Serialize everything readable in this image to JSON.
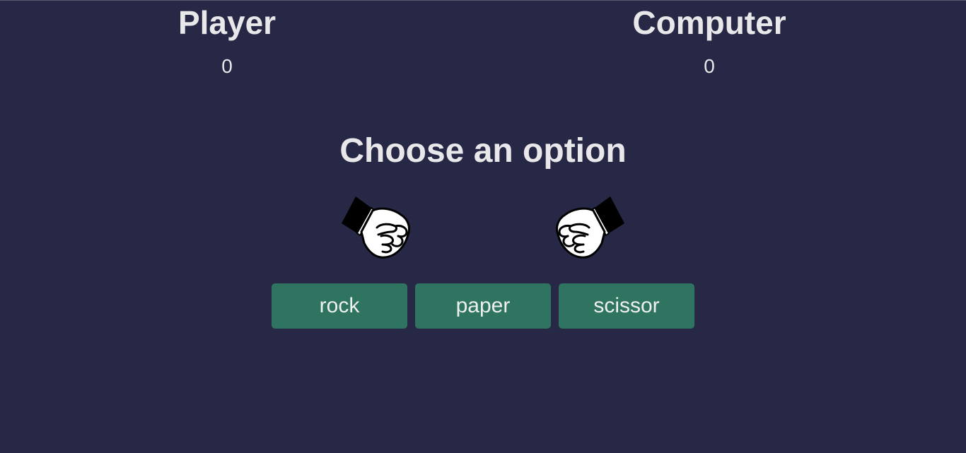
{
  "scoreboard": {
    "player": {
      "label": "Player",
      "score": "0"
    },
    "computer": {
      "label": "Computer",
      "score": "0"
    }
  },
  "prompt": "Choose an option",
  "hands": {
    "player": {
      "icon": "fist-icon",
      "facing": "right"
    },
    "computer": {
      "icon": "fist-icon",
      "facing": "left"
    }
  },
  "choices": [
    {
      "label": "rock"
    },
    {
      "label": "paper"
    },
    {
      "label": "scissor"
    }
  ],
  "colors": {
    "background": "#272845",
    "button": "#2e7461",
    "text": "#e8e8ea"
  }
}
